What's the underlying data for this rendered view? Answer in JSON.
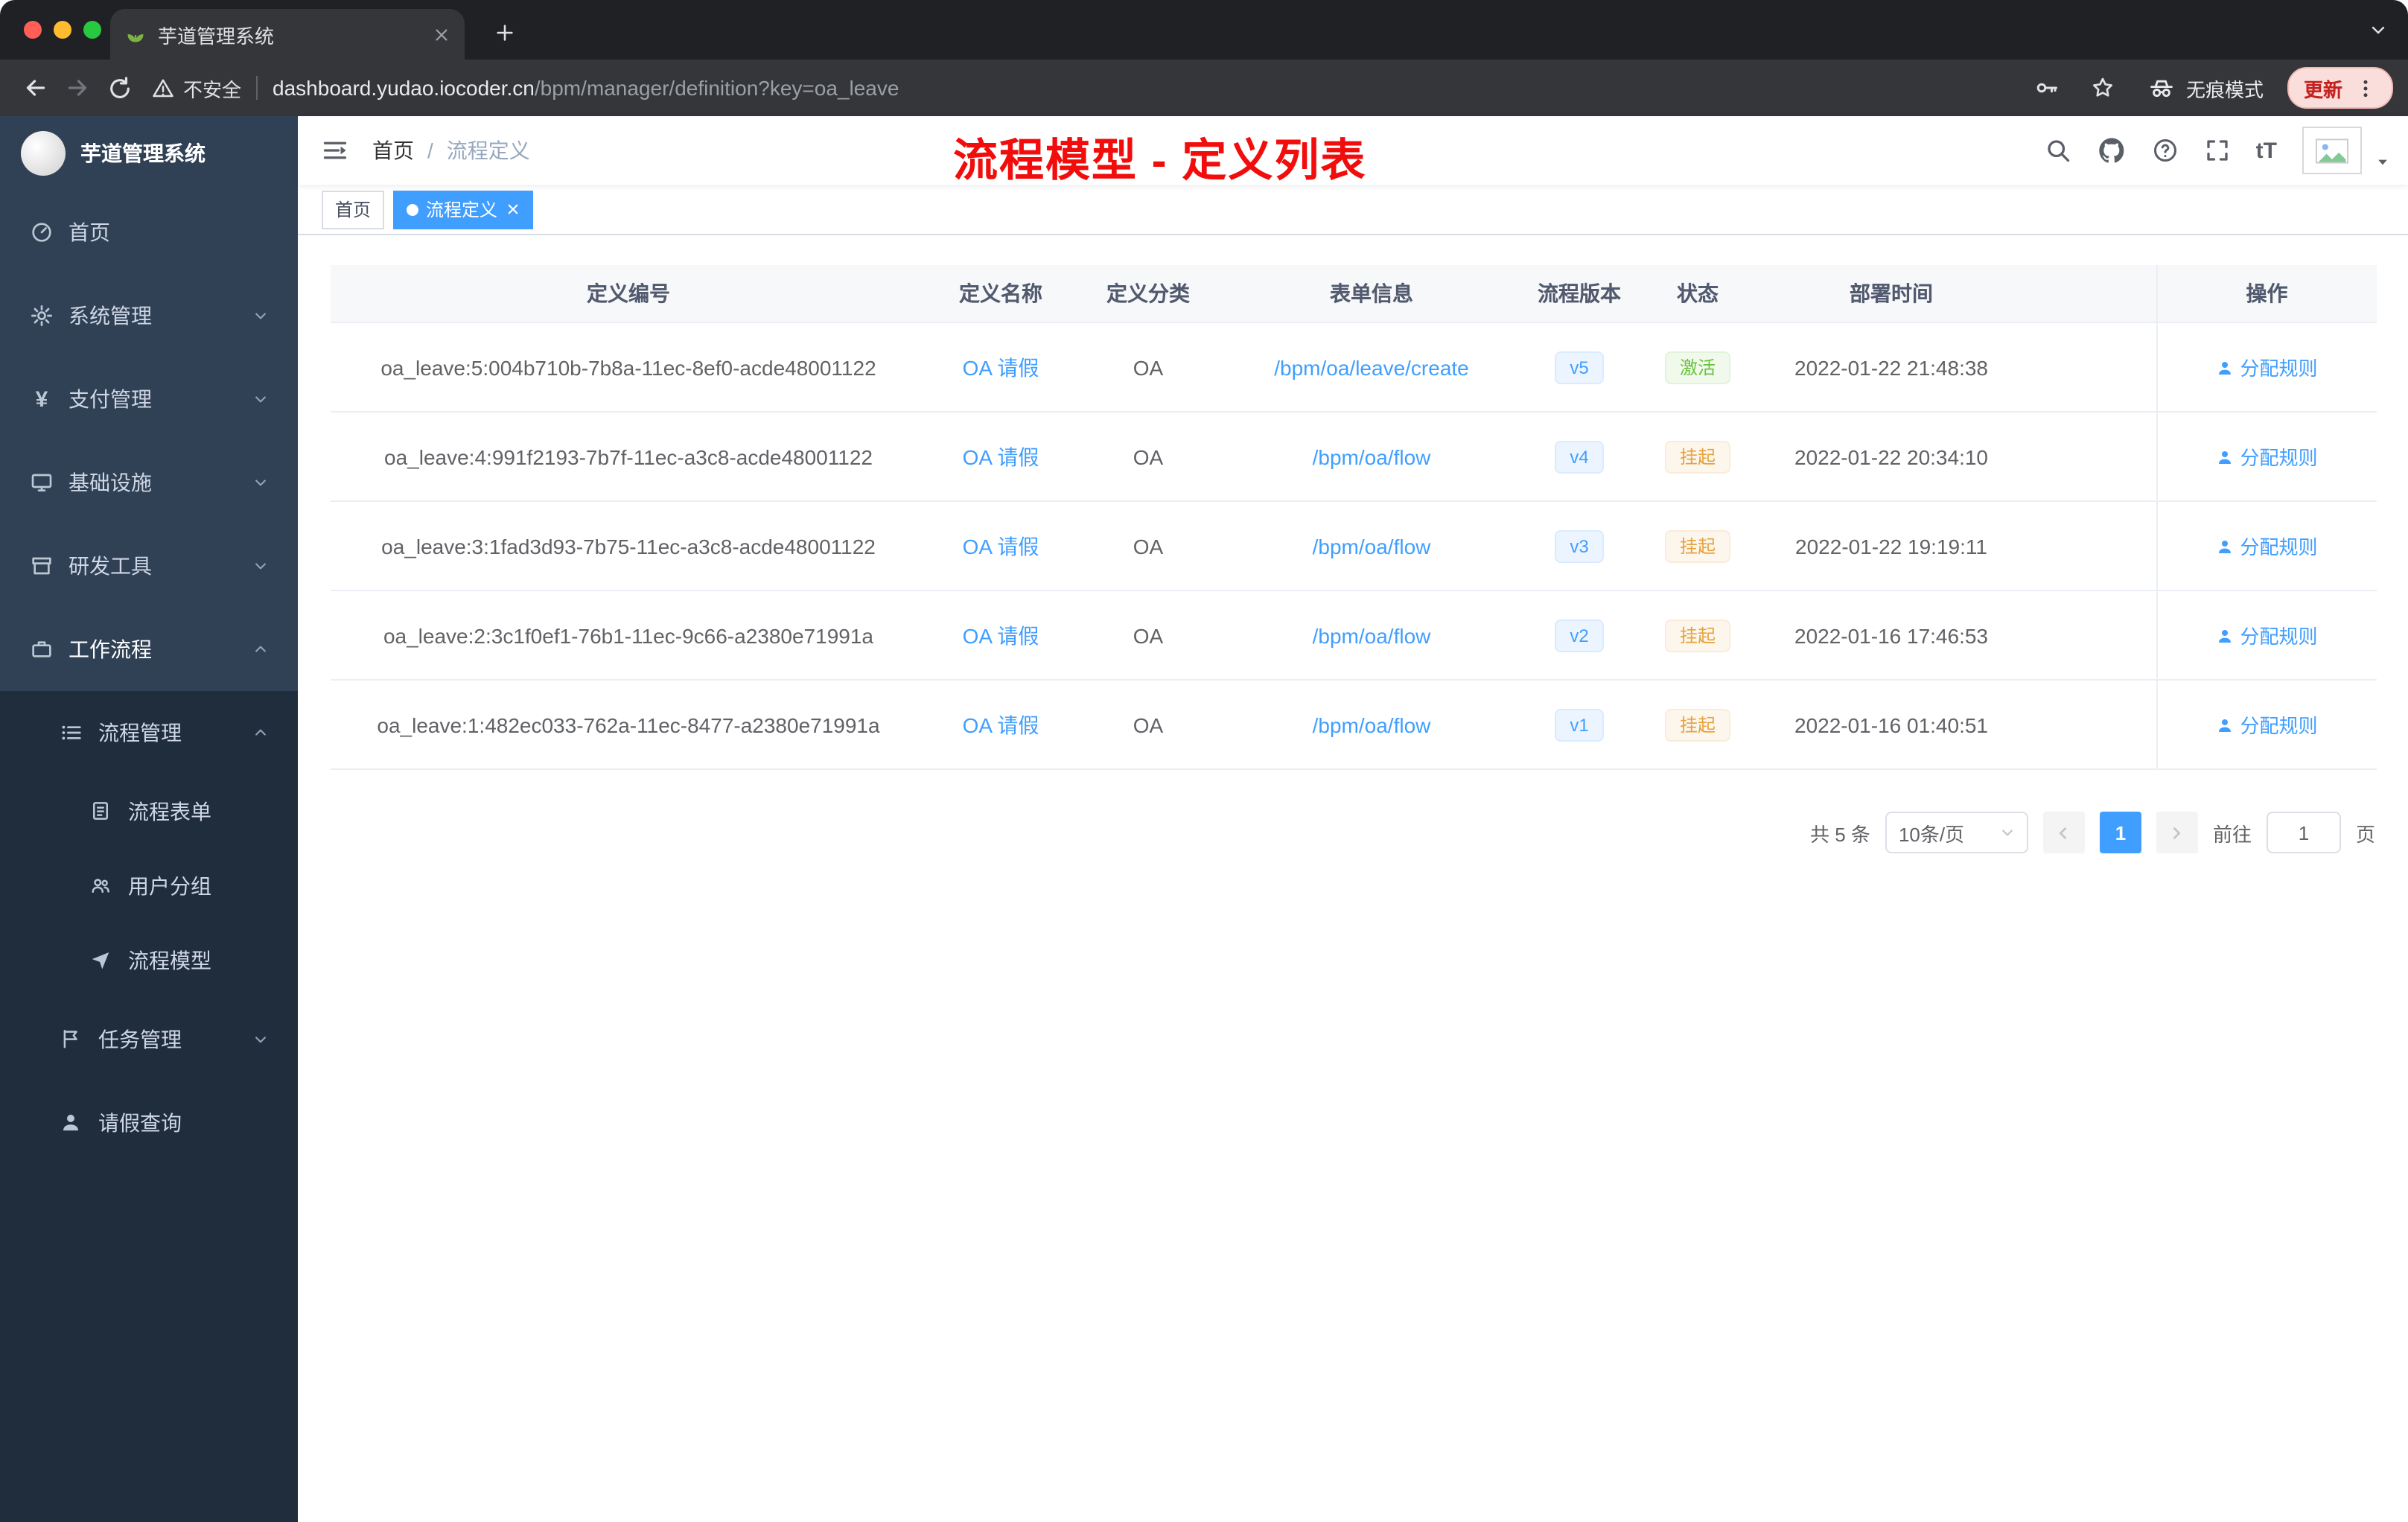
{
  "colors": {
    "accent": "#409eff",
    "annotation_red": "#f20d0d",
    "status_active_green": "#67c23a",
    "status_suspend_orange": "#e6a23c",
    "sidebar_bg": "#304156",
    "submenu_bg": "#1f2d3d"
  },
  "browser": {
    "tab": {
      "title": "芋道管理系统"
    },
    "security_label": "不安全",
    "url_host": "dashboard.yudao.iocoder.cn",
    "url_path": "/bpm/manager/definition?key=oa_leave",
    "incognito_label": "无痕模式",
    "update_label": "更新"
  },
  "sidebar": {
    "logo_title": "芋道管理系统",
    "items": [
      {
        "label": "首页",
        "icon": "dashboard-icon"
      },
      {
        "label": "系统管理",
        "icon": "gear-icon"
      },
      {
        "label": "支付管理",
        "icon": "yen-icon"
      },
      {
        "label": "基础设施",
        "icon": "monitor-icon"
      },
      {
        "label": "研发工具",
        "icon": "toolbox-icon"
      },
      {
        "label": "工作流程",
        "icon": "briefcase-icon"
      },
      {
        "label": "流程管理",
        "icon": "list-icon"
      },
      {
        "label": "流程表单",
        "icon": "form-icon"
      },
      {
        "label": "用户分组",
        "icon": "users-icon"
      },
      {
        "label": "流程模型",
        "icon": "send-icon"
      },
      {
        "label": "任务管理",
        "icon": "flag-icon"
      },
      {
        "label": "请假查询",
        "icon": "user-icon"
      }
    ]
  },
  "header": {
    "breadcrumb": {
      "home": "首页",
      "separator": "/",
      "current": "流程定义"
    },
    "annotation": "流程模型 - 定义列表",
    "fontsize_label": "tT"
  },
  "tags": {
    "home": "首页",
    "active": "流程定义"
  },
  "table": {
    "columns": [
      "定义编号",
      "定义名称",
      "定义分类",
      "表单信息",
      "流程版本",
      "状态",
      "部署时间",
      "操作"
    ],
    "rows": [
      {
        "id": "oa_leave:5:004b710b-7b8a-11ec-8ef0-acde48001122",
        "name": "OA 请假",
        "category": "OA",
        "form": "/bpm/oa/leave/create",
        "version": "v5",
        "status": "激活",
        "deploy_time": "2022-01-22 21:48:38",
        "action": "分配规则"
      },
      {
        "id": "oa_leave:4:991f2193-7b7f-11ec-a3c8-acde48001122",
        "name": "OA 请假",
        "category": "OA",
        "form": "/bpm/oa/flow",
        "version": "v4",
        "status": "挂起",
        "deploy_time": "2022-01-22 20:34:10",
        "action": "分配规则"
      },
      {
        "id": "oa_leave:3:1fad3d93-7b75-11ec-a3c8-acde48001122",
        "name": "OA 请假",
        "category": "OA",
        "form": "/bpm/oa/flow",
        "version": "v3",
        "status": "挂起",
        "deploy_time": "2022-01-22 19:19:11",
        "action": "分配规则"
      },
      {
        "id": "oa_leave:2:3c1f0ef1-76b1-11ec-9c66-a2380e71991a",
        "name": "OA 请假",
        "category": "OA",
        "form": "/bpm/oa/flow",
        "version": "v2",
        "status": "挂起",
        "deploy_time": "2022-01-16 17:46:53",
        "action": "分配规则"
      },
      {
        "id": "oa_leave:1:482ec033-762a-11ec-8477-a2380e71991a",
        "name": "OA 请假",
        "category": "OA",
        "form": "/bpm/oa/flow",
        "version": "v1",
        "status": "挂起",
        "deploy_time": "2022-01-16 01:40:51",
        "action": "分配规则"
      }
    ]
  },
  "pagination": {
    "total": "共 5 条",
    "page_size": "10条/页",
    "current_page": "1",
    "goto_label": "前往",
    "goto_value": "1",
    "goto_unit": "页"
  }
}
